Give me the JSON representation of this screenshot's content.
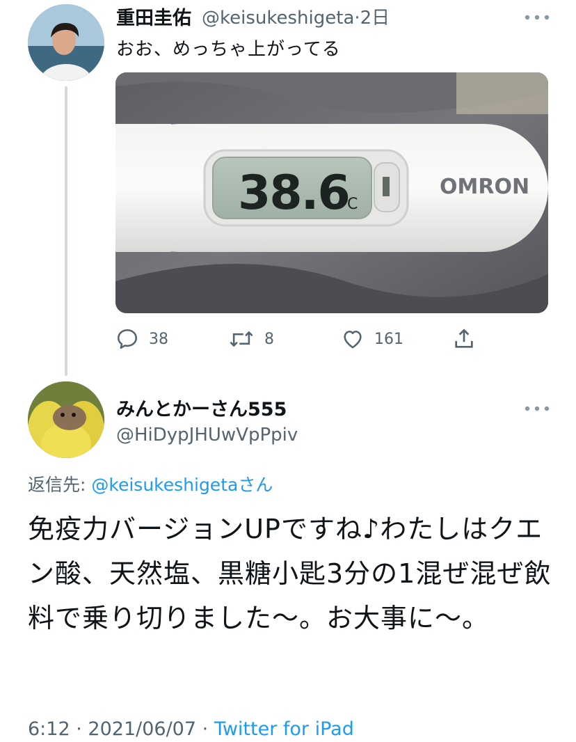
{
  "tweet1": {
    "display_name": "重田圭佑",
    "handle": "@keisukeshigeta",
    "separator": "·",
    "time": "2日",
    "text": "おお、めっちゃ上がってる",
    "media": {
      "display_reading": "38.6",
      "display_unit": "°C",
      "brand": "OMRON"
    },
    "actions": {
      "replies": "38",
      "retweets": "8",
      "likes": "161"
    }
  },
  "tweet2": {
    "display_name": "みんとかーさん555",
    "handle": "@HiDypJHUwVpPpiv",
    "reply_prefix": "返信先: ",
    "reply_mention": "@keisukeshigeta",
    "reply_suffix": "さん",
    "text": "免疫力バージョンUPですね♪わたしはクエン酸、天然塩、黒糖小匙3分の1混ぜ混ぜ飲料で乗り切りました〜。お大事に〜。",
    "time": "6:12",
    "separator": "·",
    "date": "2021/06/07",
    "separator2": "·",
    "source": "Twitter for iPad"
  },
  "colors": {
    "accent": "#1d9bf0",
    "secondary_text": "#536471",
    "thread_line": "#cfd9de"
  }
}
